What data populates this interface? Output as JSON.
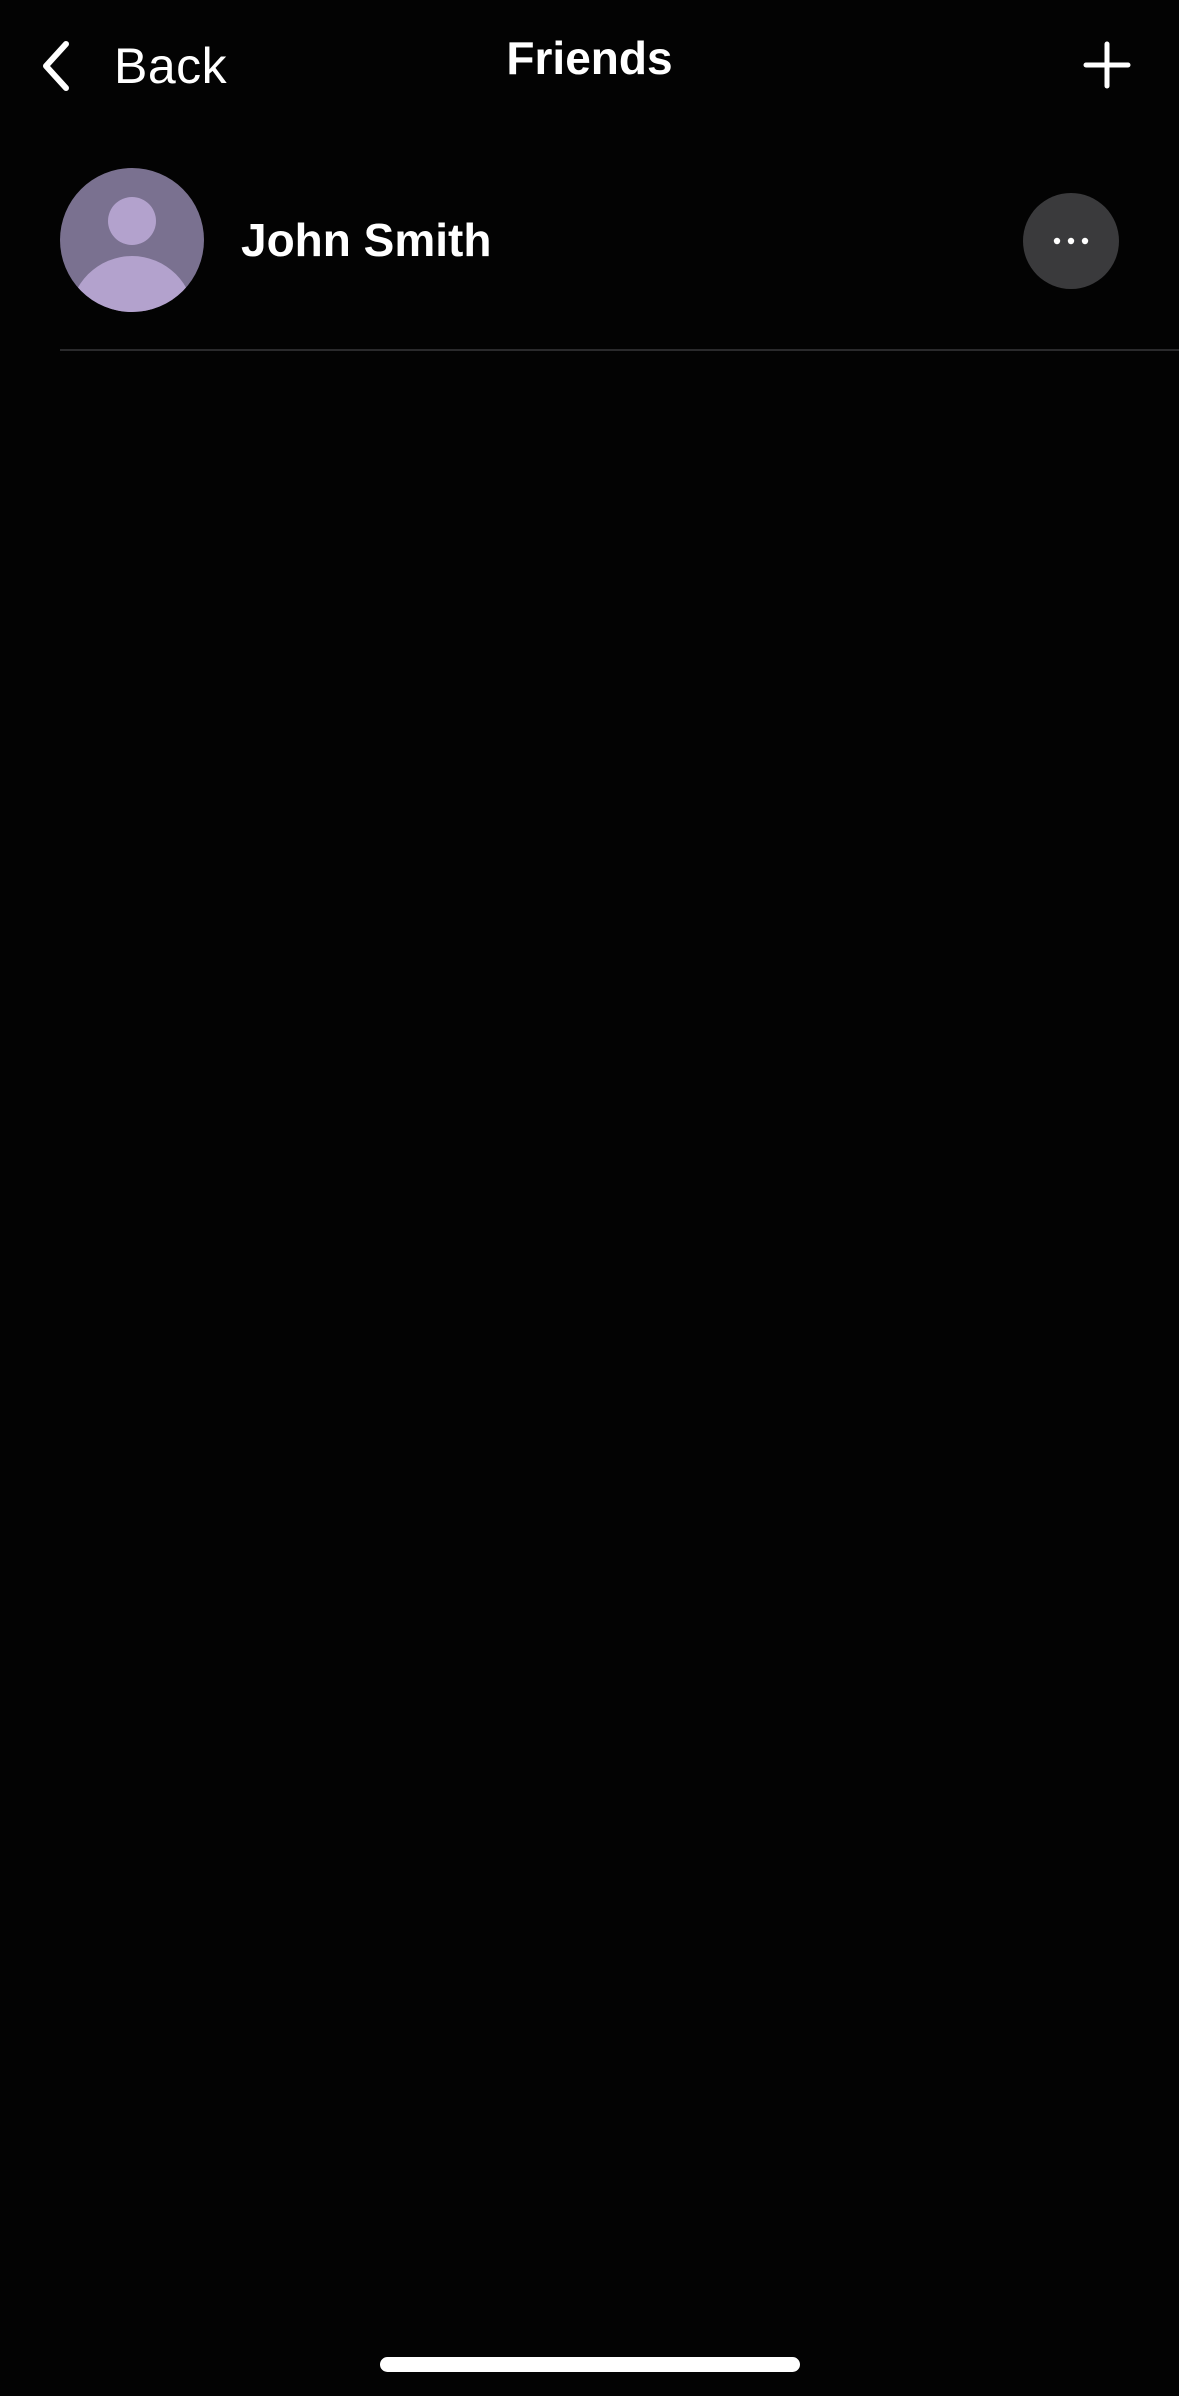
{
  "nav": {
    "back_label": "Back",
    "title": "Friends",
    "back_icon": "chevron-left-icon",
    "add_icon": "plus-icon"
  },
  "friends": [
    {
      "name": "John Smith",
      "avatar_icon": "person-silhouette-icon",
      "more_icon": "ellipsis-icon"
    }
  ],
  "colors": {
    "background": "#030303",
    "text": "#ffffff",
    "avatar_background": "#7a7190",
    "avatar_figure": "#b3a2cd",
    "more_button_background": "#3a3a3c",
    "divider": "#2a2a2c"
  }
}
